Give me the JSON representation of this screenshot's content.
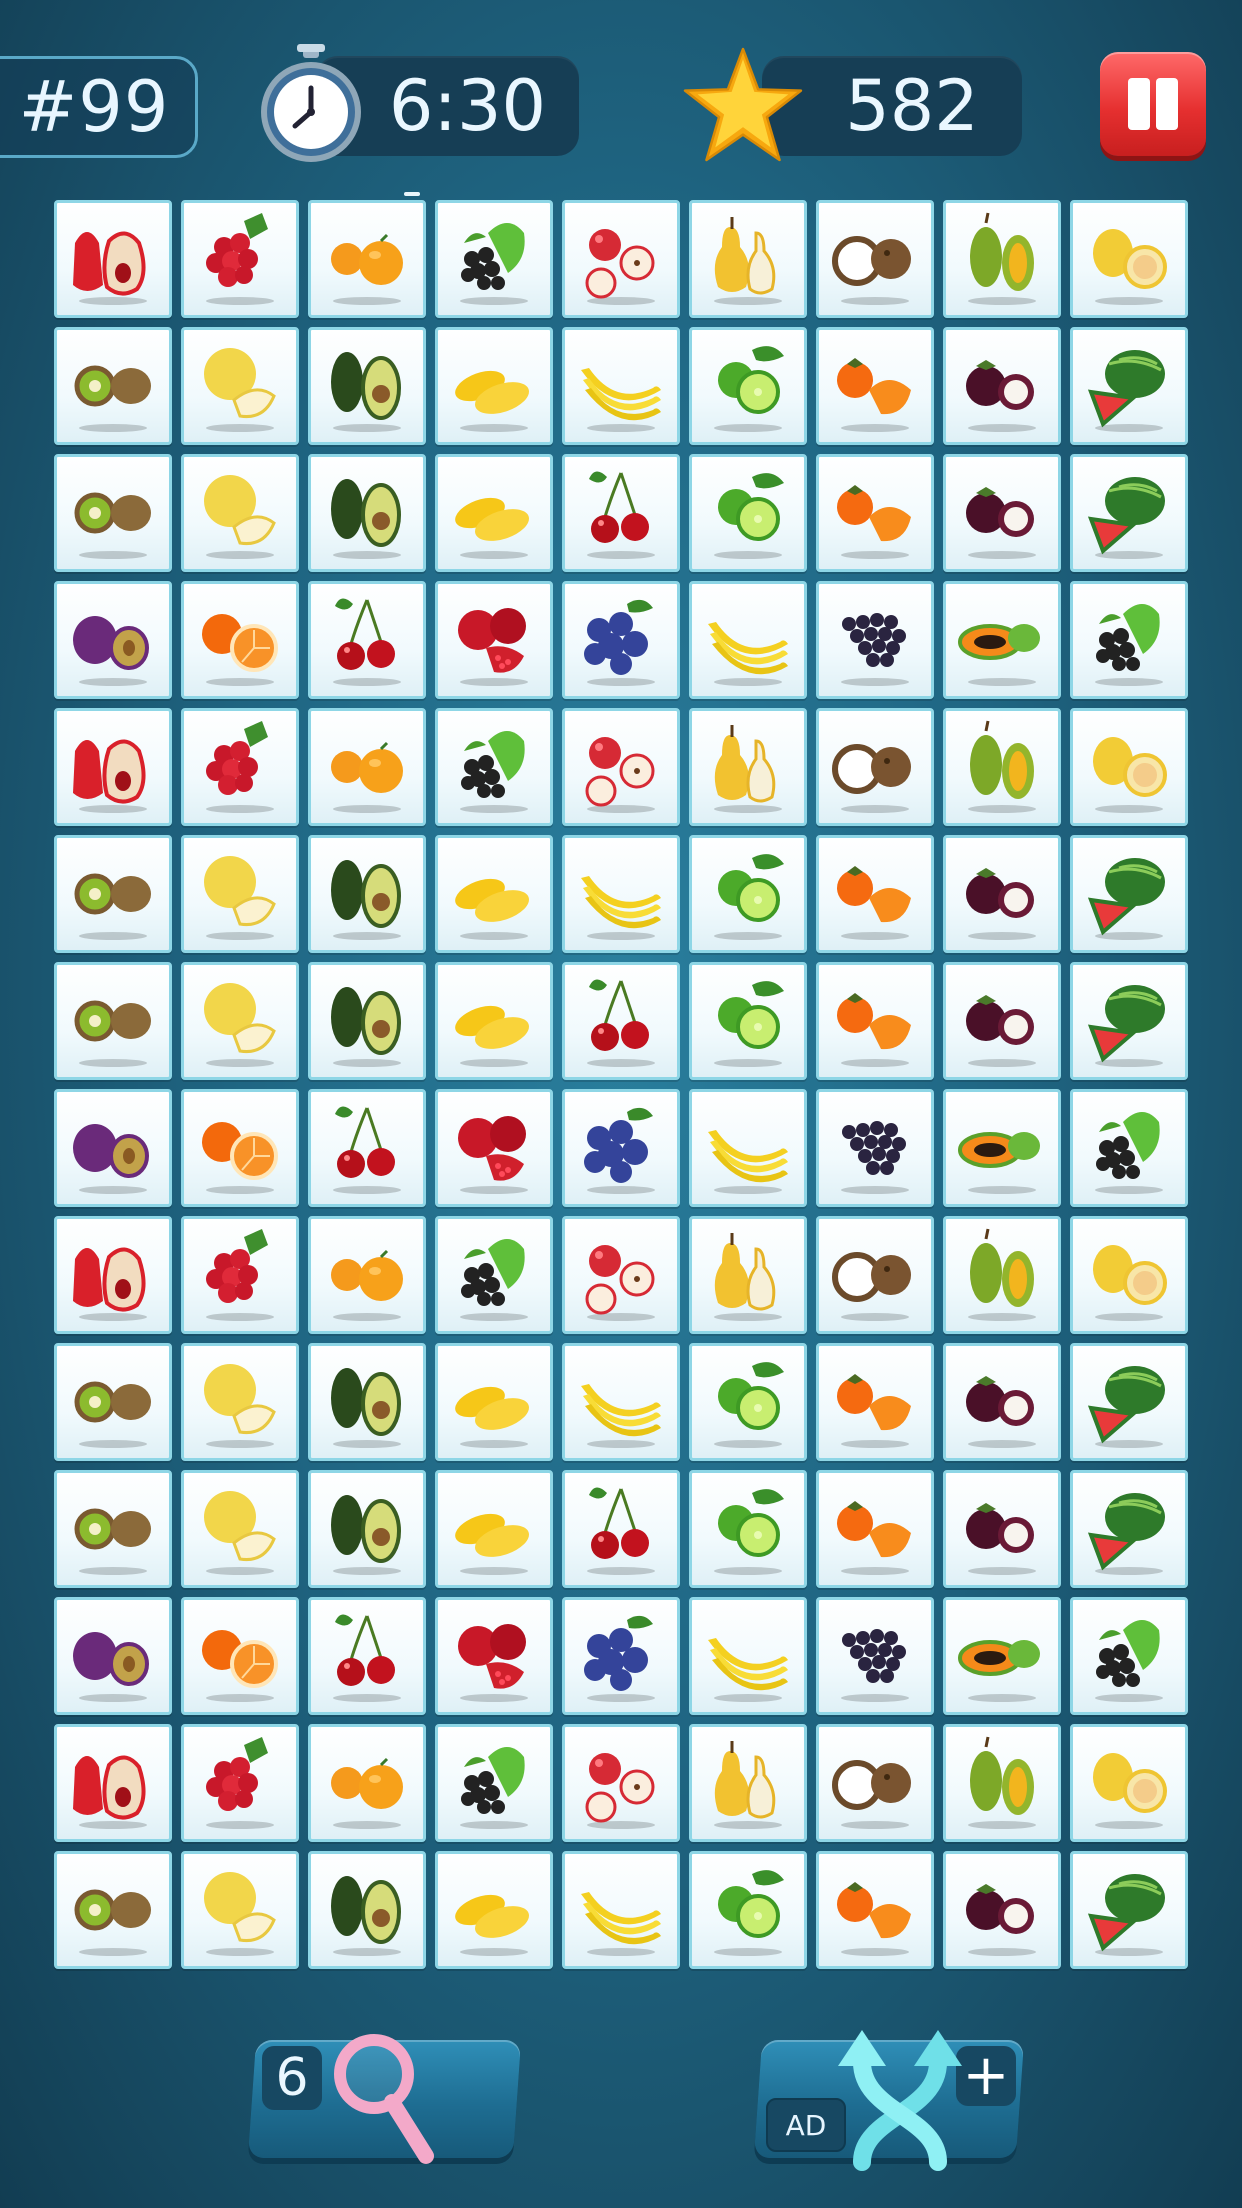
{
  "header": {
    "level": "#99",
    "timer": "6:30",
    "score": "582"
  },
  "hint_button": {
    "count": "6",
    "icon": "magnifier-icon"
  },
  "shuffle_button": {
    "ad_label": "AD",
    "plus_label": "+",
    "icon": "shuffle-arrows-icon"
  },
  "colors": {
    "background": "#1f6582",
    "tile_border": "#8ed6e6",
    "pause_red": "#e63030",
    "star_gold": "#ffc21a"
  },
  "board": {
    "columns": 9,
    "rows": 14,
    "tiles": [
      [
        "rose-apple",
        "red-currant",
        "mandarin",
        "blackberry",
        "apple",
        "pear",
        "coconut",
        "jackfruit",
        "pomelo"
      ],
      [
        "kiwi",
        "melon",
        "avocado",
        "mango",
        "banana",
        "lime",
        "persimmon",
        "mangosteen",
        "watermelon"
      ],
      [
        "kiwi",
        "melon",
        "avocado",
        "mango",
        "cherry",
        "lime",
        "persimmon",
        "mangosteen",
        "watermelon"
      ],
      [
        "plum",
        "orange",
        "cherry",
        "pomegranate",
        "blueberry",
        "banana",
        "grape",
        "papaya",
        "blackberry"
      ],
      [
        "rose-apple",
        "red-currant",
        "mandarin",
        "blackberry",
        "apple",
        "pear",
        "coconut",
        "jackfruit",
        "pomelo"
      ],
      [
        "kiwi",
        "melon",
        "avocado",
        "mango",
        "banana",
        "lime",
        "persimmon",
        "mangosteen",
        "watermelon"
      ],
      [
        "kiwi",
        "melon",
        "avocado",
        "mango",
        "cherry",
        "lime",
        "persimmon",
        "mangosteen",
        "watermelon"
      ],
      [
        "plum",
        "orange",
        "cherry",
        "pomegranate",
        "blueberry",
        "banana",
        "grape",
        "papaya",
        "blackberry"
      ],
      [
        "rose-apple",
        "red-currant",
        "mandarin",
        "blackberry",
        "apple",
        "pear",
        "coconut",
        "jackfruit",
        "pomelo"
      ],
      [
        "kiwi",
        "melon",
        "avocado",
        "mango",
        "banana",
        "lime",
        "persimmon",
        "mangosteen",
        "watermelon"
      ],
      [
        "kiwi",
        "melon",
        "avocado",
        "mango",
        "cherry",
        "lime",
        "persimmon",
        "mangosteen",
        "watermelon"
      ],
      [
        "plum",
        "orange",
        "cherry",
        "pomegranate",
        "blueberry",
        "banana",
        "grape",
        "papaya",
        "blackberry"
      ],
      [
        "rose-apple",
        "red-currant",
        "mandarin",
        "blackberry",
        "apple",
        "pear",
        "coconut",
        "jackfruit",
        "pomelo"
      ],
      [
        "kiwi",
        "melon",
        "avocado",
        "mango",
        "banana",
        "lime",
        "persimmon",
        "mangosteen",
        "watermelon"
      ]
    ]
  }
}
